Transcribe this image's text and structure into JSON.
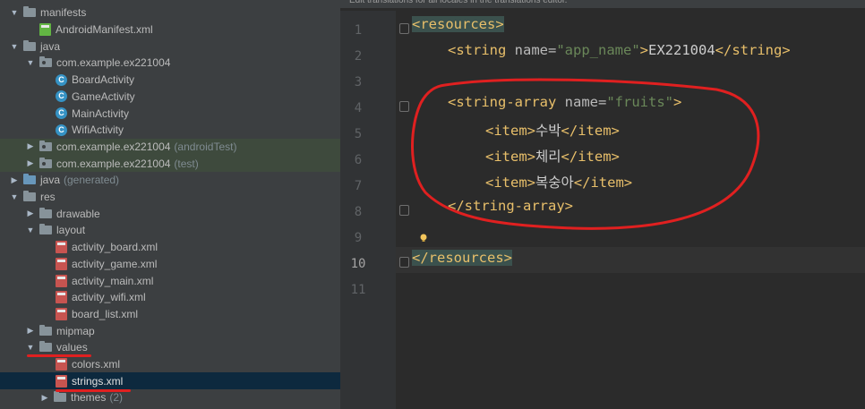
{
  "editor": {
    "banner": "Edit translations for all locales in the translations editor.",
    "line_numbers": [
      "1",
      "2",
      "3",
      "4",
      "5",
      "6",
      "7",
      "8",
      "9",
      "10",
      "11"
    ],
    "current_line": "10",
    "code": {
      "l1_open": "<resources>",
      "l2_open": "<string ",
      "l2_attr": "name=",
      "l2_val": "\"app_name\"",
      "l2_gt": ">",
      "l2_text": "EX221004",
      "l2_close": "</string>",
      "l4_open": "<string-array ",
      "l4_attr": "name=",
      "l4_val": "\"fruits\"",
      "l4_gt": ">",
      "item_open": "<item>",
      "item_close": "</item>",
      "item1": "수박",
      "item2": "체리",
      "item3": "복숭아",
      "l8_close": "</string-array>",
      "l10_close": "</resources>"
    }
  },
  "tree": {
    "manifests": "manifests",
    "android_manifest": "AndroidManifest.xml",
    "java": "java",
    "package": "com.example.ex221004",
    "classes": [
      "BoardActivity",
      "GameActivity",
      "MainActivity",
      "WifiActivity"
    ],
    "class_icon_letter": "C",
    "package_android_test": "com.example.ex221004",
    "android_test_tag": "(androidTest)",
    "package_test": "com.example.ex221004",
    "test_tag": "(test)",
    "java_generated": "java",
    "generated_tag": "(generated)",
    "res": "res",
    "drawable": "drawable",
    "layout": "layout",
    "layout_files": [
      "activity_board.xml",
      "activity_game.xml",
      "activity_main.xml",
      "activity_wifi.xml",
      "board_list.xml"
    ],
    "mipmap": "mipmap",
    "values": "values",
    "colors": "colors.xml",
    "strings": "strings.xml",
    "themes": "themes",
    "themes_count": "(2)"
  },
  "colors": {
    "annotation": "#e02020",
    "tag": "#e8bf6a",
    "string_value": "#6a8759"
  }
}
